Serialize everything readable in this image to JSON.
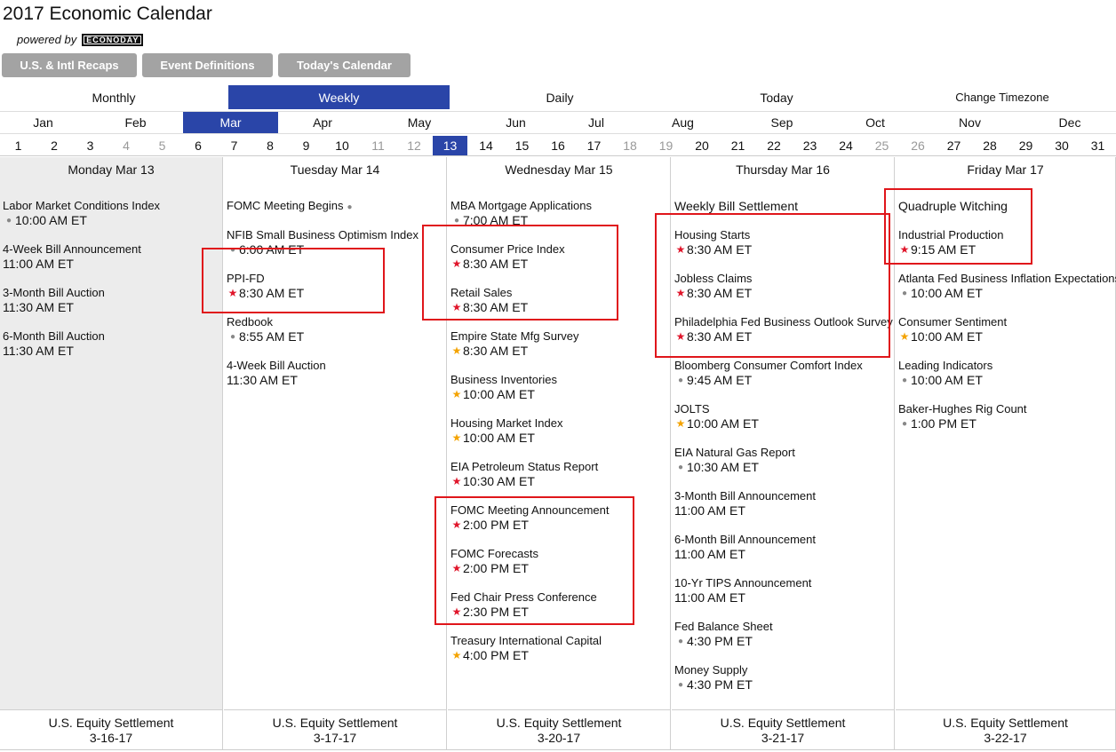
{
  "title": "2017 Economic Calendar",
  "powered": {
    "label": "powered by",
    "logo_text": "ECONODAY"
  },
  "buttons": [
    "U.S. & Intl Recaps",
    "Event Definitions",
    "Today's Calendar"
  ],
  "views": {
    "monthly": "Monthly",
    "weekly": "Weekly",
    "daily": "Daily",
    "today": "Today",
    "timezone": "Change Timezone",
    "active": "weekly"
  },
  "months": [
    "Jan",
    "Feb",
    "Mar",
    "Apr",
    "May",
    "Jun",
    "Jul",
    "Aug",
    "Sep",
    "Oct",
    "Nov",
    "Dec"
  ],
  "active_month": "Mar",
  "days": [
    "1",
    "2",
    "3",
    "4",
    "5",
    "6",
    "7",
    "8",
    "9",
    "10",
    "11",
    "12",
    "13",
    "14",
    "15",
    "16",
    "17",
    "18",
    "19",
    "20",
    "21",
    "22",
    "23",
    "24",
    "25",
    "26",
    "27",
    "28",
    "29",
    "30",
    "31"
  ],
  "weekend_days": [
    "4",
    "5",
    "11",
    "12",
    "18",
    "19",
    "25",
    "26"
  ],
  "active_day": "13",
  "colors": {
    "accent": "#2a45a8",
    "gray_button": "#a3a3a3",
    "high_importance": "#e0162b",
    "medium_importance": "#f4a300",
    "highlight_box": "#e0161b"
  },
  "columns": [
    {
      "header": "Monday Mar 13",
      "events": [
        {
          "name": "Labor Market Conditions Index",
          "time": "10:00 AM ET",
          "marker": "dot"
        },
        {
          "name": "4-Week Bill Announcement",
          "time": "11:00 AM ET",
          "marker": "none"
        },
        {
          "name": "3-Month Bill Auction",
          "time": "11:30 AM ET",
          "marker": "none"
        },
        {
          "name": "6-Month Bill Auction",
          "time": "11:30 AM ET",
          "marker": "none"
        }
      ],
      "footer": {
        "label": "U.S. Equity Settlement",
        "date": "3-16-17"
      }
    },
    {
      "header": "Tuesday Mar 14",
      "events": [
        {
          "name": "FOMC Meeting Begins",
          "name_marker": "dot",
          "time": "",
          "marker": "none",
          "compact": true
        },
        {
          "name": "NFIB Small Business Optimism Index",
          "time": "6:00 AM ET",
          "marker": "dot"
        },
        {
          "name": "PPI-FD",
          "time": "8:30 AM ET",
          "marker": "red"
        },
        {
          "name": "Redbook",
          "time": "8:55 AM ET",
          "marker": "dot"
        },
        {
          "name": "4-Week Bill Auction",
          "time": "11:30 AM ET",
          "marker": "none"
        }
      ],
      "footer": {
        "label": "U.S. Equity Settlement",
        "date": "3-17-17"
      }
    },
    {
      "header": "Wednesday Mar 15",
      "events": [
        {
          "name": "MBA Mortgage Applications",
          "time": "7:00 AM ET",
          "marker": "dot"
        },
        {
          "name": "Consumer Price Index",
          "time": "8:30 AM ET",
          "marker": "red"
        },
        {
          "name": "Retail Sales",
          "time": "8:30 AM ET",
          "marker": "red"
        },
        {
          "name": "Empire State Mfg Survey",
          "time": "8:30 AM ET",
          "marker": "gold"
        },
        {
          "name": "Business Inventories",
          "time": "10:00 AM ET",
          "marker": "gold"
        },
        {
          "name": "Housing Market Index",
          "time": "10:00 AM ET",
          "marker": "gold"
        },
        {
          "name": "EIA Petroleum Status Report",
          "time": "10:30 AM ET",
          "marker": "red"
        },
        {
          "name": "FOMC Meeting Announcement",
          "time": "2:00 PM ET",
          "marker": "red"
        },
        {
          "name": "FOMC Forecasts",
          "time": "2:00 PM ET",
          "marker": "red"
        },
        {
          "name": "Fed Chair Press Conference",
          "time": "2:30 PM ET",
          "marker": "red"
        },
        {
          "name": "Treasury International Capital",
          "time": "4:00 PM ET",
          "marker": "gold"
        }
      ],
      "footer": {
        "label": "U.S. Equity Settlement",
        "date": "3-20-17"
      }
    },
    {
      "header": "Thursday Mar 16",
      "events": [
        {
          "name": "Weekly Bill Settlement",
          "time": "",
          "marker": "none",
          "compact": true,
          "big": true
        },
        {
          "name": "Housing Starts",
          "time": "8:30 AM ET",
          "marker": "red"
        },
        {
          "name": "Jobless Claims",
          "time": "8:30 AM ET",
          "marker": "red"
        },
        {
          "name": "Philadelphia Fed Business Outlook Survey",
          "time": "8:30 AM ET",
          "marker": "red"
        },
        {
          "name": "Bloomberg Consumer Comfort Index",
          "time": "9:45 AM ET",
          "marker": "dot"
        },
        {
          "name": "JOLTS",
          "time": "10:00 AM ET",
          "marker": "gold"
        },
        {
          "name": "EIA Natural Gas Report",
          "time": "10:30 AM ET",
          "marker": "dot"
        },
        {
          "name": "3-Month Bill Announcement",
          "time": "11:00 AM ET",
          "marker": "none"
        },
        {
          "name": "6-Month Bill Announcement",
          "time": "11:00 AM ET",
          "marker": "none"
        },
        {
          "name": "10-Yr TIPS Announcement",
          "time": "11:00 AM ET",
          "marker": "none"
        },
        {
          "name": "Fed Balance Sheet",
          "time": "4:30 PM ET",
          "marker": "dot"
        },
        {
          "name": "Money Supply",
          "time": "4:30 PM ET",
          "marker": "dot"
        }
      ],
      "footer": {
        "label": "U.S. Equity Settlement",
        "date": "3-21-17"
      }
    },
    {
      "header": "Friday Mar 17",
      "events": [
        {
          "name": "Quadruple Witching",
          "time": "",
          "marker": "none",
          "compact": true,
          "big": true
        },
        {
          "name": "Industrial Production",
          "time": "9:15 AM ET",
          "marker": "red"
        },
        {
          "name": "Atlanta Fed Business Inflation Expectations",
          "time": "10:00 AM ET",
          "marker": "dot"
        },
        {
          "name": "Consumer Sentiment",
          "time": "10:00 AM ET",
          "marker": "gold"
        },
        {
          "name": "Leading Indicators",
          "time": "10:00 AM ET",
          "marker": "dot"
        },
        {
          "name": "Baker-Hughes Rig Count",
          "time": "1:00 PM ET",
          "marker": "dot"
        }
      ],
      "footer": {
        "label": "U.S. Equity Settlement",
        "date": "3-22-17"
      }
    }
  ]
}
